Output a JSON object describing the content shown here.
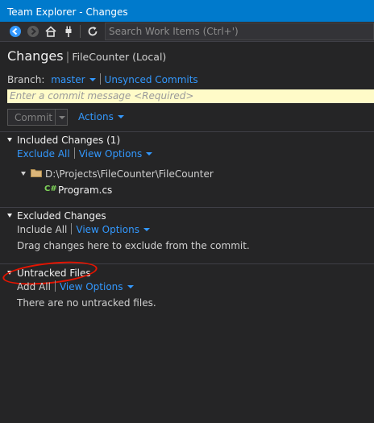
{
  "window": {
    "title": "Team Explorer - Changes"
  },
  "toolbar": {
    "icons": [
      "back-icon",
      "forward-icon",
      "home-icon",
      "connect-icon",
      "refresh-icon"
    ],
    "search_placeholder": "Search Work Items (Ctrl+')"
  },
  "header": {
    "title": "Changes",
    "subtitle": "FileCounter (Local)"
  },
  "branch": {
    "label": "Branch:",
    "name": "master",
    "unsynced": "Unsynced Commits"
  },
  "commit": {
    "message_placeholder": "Enter a commit message <Required>",
    "button": "Commit",
    "actions": "Actions"
  },
  "included": {
    "title": "Included Changes (1)",
    "exclude_all": "Exclude All",
    "view_options": "View Options",
    "folder_path": "D:\\Projects\\FileCounter\\FileCounter",
    "file_badge": "C#",
    "file_name": "Program.cs"
  },
  "excluded": {
    "title": "Excluded Changes",
    "include_all": "Include All",
    "view_options": "View Options",
    "hint": "Drag changes here to exclude from the commit."
  },
  "untracked": {
    "title": "Untracked Files",
    "add_all": "Add All",
    "view_options": "View Options",
    "empty": "There are no untracked files."
  },
  "colors": {
    "accent": "#007acc",
    "link": "#3399ff",
    "background": "#252526",
    "highlight": "#e51400",
    "commit_field": "#fffbc8"
  }
}
